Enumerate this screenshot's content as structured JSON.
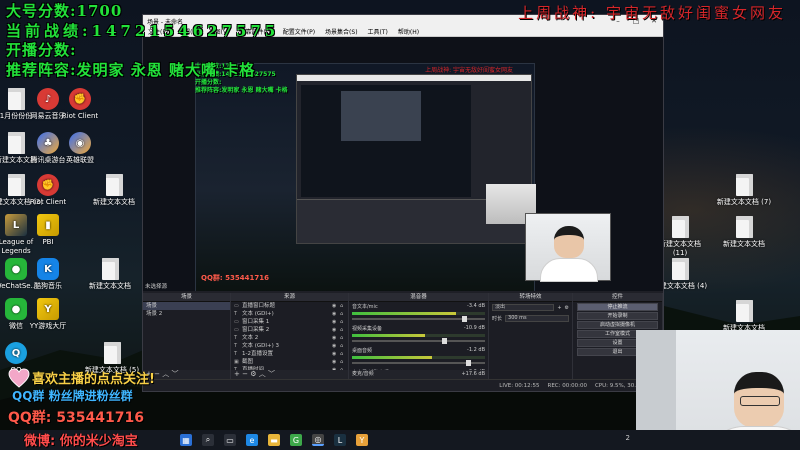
{
  "overlay_stats": {
    "line1": "大号分数:1700",
    "line2": "当前战绩:1472154627575",
    "line3": "开播分数:",
    "line4": "推荐阵容:发明家 永恩 赌大嘴 卡格"
  },
  "banner": {
    "text": "上周战神: 宇宙无敌好闺蜜女网友"
  },
  "promo": {
    "follow": "喜欢主播的点点关注!",
    "fans": "QQ群 粉丝牌进粉丝群",
    "qq": "QQ群: 535441716",
    "taobao": "微博: 你的米少淘宝"
  },
  "desktop_icons": [
    {
      "label": "1月份份份",
      "icon": "doc-icon"
    },
    {
      "label": "网易云音乐",
      "icon": "music-icon"
    },
    {
      "label": "Riot Client",
      "icon": "riot-icon"
    },
    {
      "label": "新建文本文档",
      "icon": "doc-icon"
    },
    {
      "label": "腾讯桌游台",
      "icon": "game-icon"
    },
    {
      "label": "英雄联盟",
      "icon": "game-icon"
    },
    {
      "label": "新建文本文档 (3)",
      "icon": "doc-icon"
    },
    {
      "label": "Riot Client",
      "icon": "riot-icon"
    },
    {
      "label": "新建文本文档",
      "icon": "doc-icon"
    },
    {
      "label": "League of Legends",
      "icon": "lol-icon"
    },
    {
      "label": "PBI",
      "icon": "pbi-icon"
    },
    {
      "label": "WeChatSe...",
      "icon": "wechat-icon"
    },
    {
      "label": "酷狗音乐",
      "icon": "kugou-icon"
    },
    {
      "label": "新建文本文档",
      "icon": "doc-icon"
    },
    {
      "label": "微信",
      "icon": "wechat-icon"
    },
    {
      "label": "YY游戏大厅",
      "icon": "yy-icon"
    },
    {
      "label": "QQ",
      "icon": "qq-icon"
    },
    {
      "label": "新建文本文档 (5)",
      "icon": "doc-icon"
    },
    {
      "label": "新建文本文档 (7)",
      "icon": "doc-icon"
    },
    {
      "label": "新建文本文档 (11)",
      "icon": "doc-icon"
    },
    {
      "label": "新建文本文档",
      "icon": "doc-icon"
    },
    {
      "label": "新建文本文档 (4)",
      "icon": "doc-icon"
    },
    {
      "label": "新建文本文档",
      "icon": "doc-icon"
    }
  ],
  "obs": {
    "window_title": "场景 - 未命名",
    "menu": [
      "文件(F)",
      "编辑(E)",
      "视图(V)",
      "停靠部件(D)",
      "配置文件(P)",
      "场景集合(S)",
      "工具(T)",
      "帮助(H)"
    ],
    "preview_scene_label": "未选择源",
    "panels": {
      "scenes_title": "场景",
      "sources_title": "来源",
      "mixer_title": "混音器",
      "transitions_title": "转场特效",
      "controls_title": "控件"
    },
    "scenes": [
      "场景",
      "场景 2"
    ],
    "sources": [
      {
        "label": "直播窗口标题",
        "icon": "window-icon"
      },
      {
        "label": "文本 (GDI+)",
        "icon": "text-icon"
      },
      {
        "label": "窗口采集 1",
        "icon": "window-icon"
      },
      {
        "label": "窗口采集 2",
        "icon": "window-icon"
      },
      {
        "label": "文本 2",
        "icon": "text-icon"
      },
      {
        "label": "文本 (GDI+) 3",
        "icon": "text-icon"
      },
      {
        "label": "1-2直播设置",
        "icon": "text-icon"
      },
      {
        "label": "截图",
        "icon": "image-icon"
      },
      {
        "label": "直播时间",
        "icon": "text-icon"
      },
      {
        "label": "视频采集设备",
        "icon": "camera-icon"
      }
    ],
    "mixer": [
      {
        "name": "音文本/mic",
        "db": "-3.4 dB",
        "level": 0.78,
        "volume": 0.85
      },
      {
        "name": "视频采集设备",
        "db": "-10.9 dB",
        "level": 0.55,
        "volume": 0.7
      },
      {
        "name": "桌面音频",
        "db": "-1.2 dB",
        "level": 0.6,
        "volume": 0.88
      },
      {
        "name": "麦克风/辅助音频",
        "db": "-3.3 dB",
        "level": 0.45,
        "volume": 0.8
      }
    ],
    "mixer_footer": "麦克/音频",
    "mixer_footer_db": "+17.6 dB",
    "transition": {
      "type": "淡出",
      "duration_label": "时长",
      "duration": "300 ms"
    },
    "controls": [
      "停止推流",
      "开始录制",
      "启动虚拟摄像机",
      "工作室模式",
      "设置",
      "退出"
    ],
    "status": {
      "live": "LIVE: 00:12:55",
      "rec": "REC: 00:00:00",
      "cpu": "CPU: 9.5%, 30.00 fps"
    }
  },
  "embedded": {
    "qq": "QQ群: 535441716"
  },
  "taskbar": {
    "icons": [
      "windows-icon",
      "search-icon",
      "taskview-icon",
      "edge-icon",
      "folder-icon",
      "chrome-icon",
      "obs-icon",
      "lol-icon",
      "yy-icon"
    ],
    "tray_time": "2"
  }
}
